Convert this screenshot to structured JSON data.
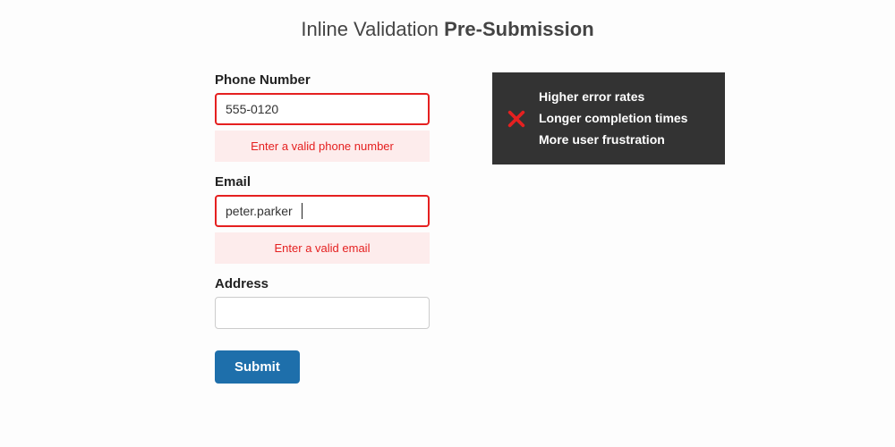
{
  "title": {
    "prefix": "Inline Validation ",
    "bold": "Pre-Submission"
  },
  "form": {
    "phone": {
      "label": "Phone Number",
      "value": "555-0120",
      "error": "Enter a valid phone number"
    },
    "email": {
      "label": "Email",
      "value": "peter.parker",
      "error": "Enter a valid email"
    },
    "address": {
      "label": "Address",
      "value": ""
    },
    "submit_label": "Submit"
  },
  "callout": {
    "icon": "x-icon",
    "items": [
      "Higher error rates",
      "Longer completion times",
      "More user frustration"
    ]
  },
  "colors": {
    "error": "#e52020",
    "error_bg": "#fdecec",
    "button": "#1e6fab",
    "callout_bg": "#333333"
  }
}
